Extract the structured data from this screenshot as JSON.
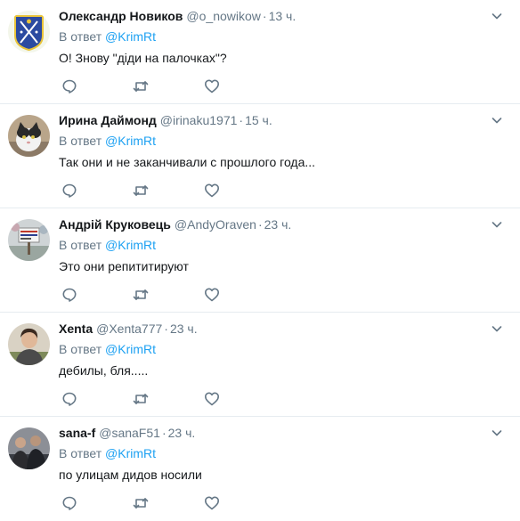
{
  "tweets": [
    {
      "name": "Олександр Новиков",
      "handle": "@o_nowikow",
      "time": "13 ч.",
      "reply_prefix": "В ответ",
      "reply_to": "@KrimRt",
      "text": "О! Знову \"діди на палочках\"?",
      "avatar": "coat-of-arms"
    },
    {
      "name": "Ирина Даймонд",
      "handle": "@irinaku1971",
      "time": "15 ч.",
      "reply_prefix": "В ответ",
      "reply_to": "@KrimRt",
      "text": "Так они и не заканчивали с прошлого года...",
      "avatar": "cat-photo"
    },
    {
      "name": "Андрій Круковець",
      "handle": "@AndyOraven",
      "time": "23 ч.",
      "reply_prefix": "В ответ",
      "reply_to": "@KrimRt",
      "text": "Это они репититируют",
      "avatar": "sign-photo"
    },
    {
      "name": "Xenta",
      "handle": "@Xenta777",
      "time": "23 ч.",
      "reply_prefix": "В ответ",
      "reply_to": "@KrimRt",
      "text": "дебилы, бля.....",
      "avatar": "person-photo"
    },
    {
      "name": "sana-f",
      "handle": "@sanaF51",
      "time": "23 ч.",
      "reply_prefix": "В ответ",
      "reply_to": "@KrimRt",
      "text": "по улицам дидов носили",
      "avatar": "group-photo"
    }
  ],
  "colors": {
    "link": "#1da1f2",
    "muted": "#657786",
    "divider": "#e6ecf0"
  }
}
